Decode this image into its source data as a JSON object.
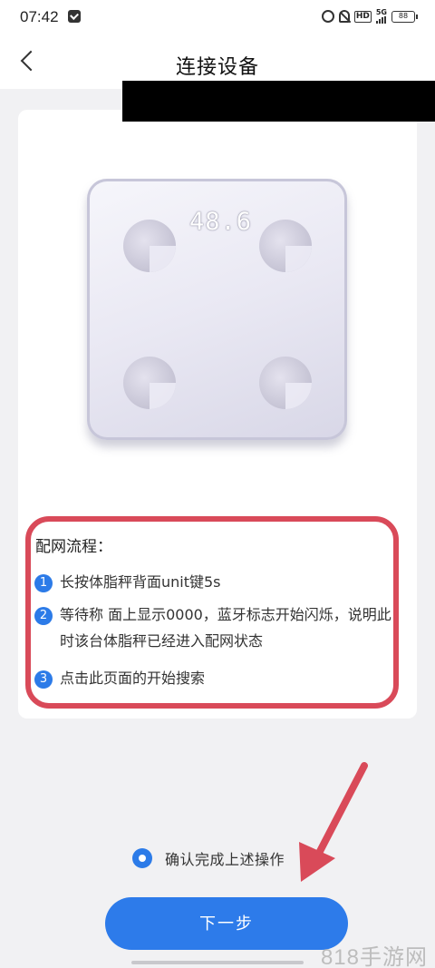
{
  "status_bar": {
    "time": "07:42",
    "hd_label": "HD",
    "network": "5G",
    "battery": "88"
  },
  "nav": {
    "title": "连接设备"
  },
  "device": {
    "display_reading": "48.6"
  },
  "steps": {
    "title": "配网流程：",
    "items": [
      {
        "num": "1",
        "text": "长按体脂秤背面unit键5s"
      },
      {
        "num": "2",
        "text": "等待称 面上显示0000，蓝牙标志开始闪烁，说明此时该台体脂秤已经进入配网状态"
      },
      {
        "num": "3",
        "text": "点击此页面的开始搜索"
      }
    ]
  },
  "confirm": {
    "label": "确认完成上述操作"
  },
  "next_button": {
    "label": "下一步"
  },
  "watermark": "818手游网",
  "colors": {
    "accent": "#2d7bea",
    "annotation": "#d94a59",
    "background": "#f1f1f3"
  },
  "icons": [
    "back-arrow-icon",
    "mail-icon",
    "alarm-icon",
    "mute-icon",
    "signal-icon",
    "battery-icon"
  ]
}
